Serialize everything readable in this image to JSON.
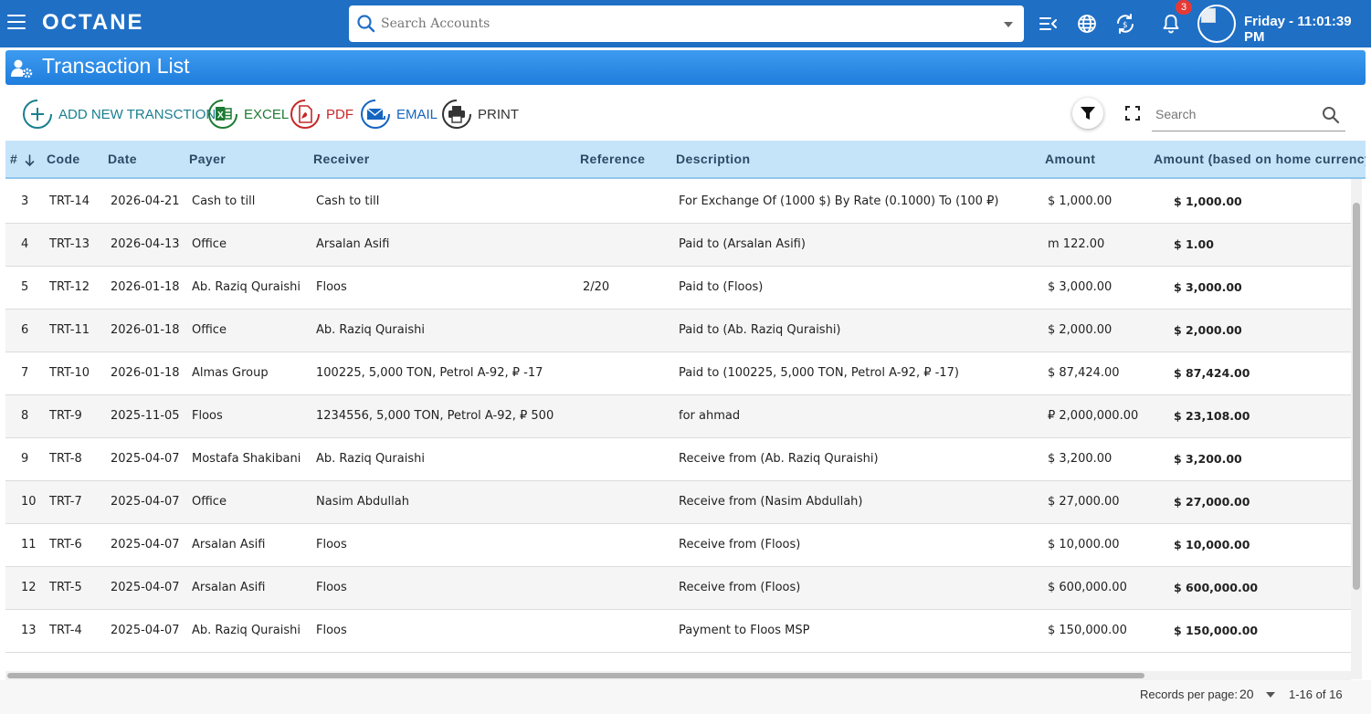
{
  "topbar": {
    "logo": "OCTANE",
    "account_search_placeholder": "Search Accounts",
    "notification_count": "3",
    "clock": "Friday - 11:01:39 PM"
  },
  "page": {
    "title": "Transaction List"
  },
  "toolbar": {
    "add_label": "ADD NEW TRANSCTION",
    "excel_label": "EXCEL",
    "pdf_label": "PDF",
    "email_label": "EMAIL",
    "print_label": "PRINT",
    "search_placeholder": "Search"
  },
  "colors": {
    "topbar": "#1f6fc5",
    "header_row": "#c6e4f9",
    "add": "#1a7f8f",
    "excel": "#1e7b34",
    "pdf": "#c62828",
    "email": "#1565c0",
    "print": "#333333"
  },
  "table": {
    "columns": [
      "#",
      "Code",
      "Date",
      "Payer",
      "Receiver",
      "Reference",
      "Description",
      "Amount",
      "Amount (based on home currency)"
    ],
    "rows": [
      [
        "3",
        "TRT-14",
        "2026-04-21",
        "Cash to till",
        "Cash to till",
        "",
        "For Exchange Of (1000 $) By Rate (0.1000) To (100 ₽)",
        "$ 1,000.00",
        "$ 1,000.00"
      ],
      [
        "4",
        "TRT-13",
        "2026-04-13",
        "Office",
        "Arsalan Asifi",
        "",
        "Paid to (Arsalan Asifi)",
        "m 122.00",
        "$ 1.00"
      ],
      [
        "5",
        "TRT-12",
        "2026-01-18",
        "Ab. Raziq Quraishi",
        "Floos",
        "2/20",
        "Paid to (Floos)",
        "$ 3,000.00",
        "$ 3,000.00"
      ],
      [
        "6",
        "TRT-11",
        "2026-01-18",
        "Office",
        "Ab. Raziq Quraishi",
        "",
        "Paid to (Ab. Raziq Quraishi)",
        "$ 2,000.00",
        "$ 2,000.00"
      ],
      [
        "7",
        "TRT-10",
        "2026-01-18",
        "Almas Group",
        "100225, 5,000 TON, Petrol A-92, ₽ -17",
        "",
        "Paid to (100225, 5,000 TON, Petrol A-92, ₽ -17)",
        "$ 87,424.00",
        "$ 87,424.00"
      ],
      [
        "8",
        "TRT-9",
        "2025-11-05",
        "Floos",
        "1234556, 5,000 TON, Petrol A-92, ₽ 500",
        "",
        "for ahmad",
        "₽ 2,000,000.00",
        "$ 23,108.00"
      ],
      [
        "9",
        "TRT-8",
        "2025-04-07",
        "Mostafa Shakibani",
        "Ab. Raziq Quraishi",
        "",
        "Receive from (Ab. Raziq Quraishi)",
        "$ 3,200.00",
        "$ 3,200.00"
      ],
      [
        "10",
        "TRT-7",
        "2025-04-07",
        "Office",
        "Nasim Abdullah",
        "",
        "Receive from (Nasim Abdullah)",
        "$ 27,000.00",
        "$ 27,000.00"
      ],
      [
        "11",
        "TRT-6",
        "2025-04-07",
        "Arsalan Asifi",
        "Floos",
        "",
        "Receive from (Floos)",
        "$ 10,000.00",
        "$ 10,000.00"
      ],
      [
        "12",
        "TRT-5",
        "2025-04-07",
        "Arsalan Asifi",
        "Floos",
        "",
        "Receive from (Floos)",
        "$ 600,000.00",
        "$ 600,000.00"
      ],
      [
        "13",
        "TRT-4",
        "2025-04-07",
        "Ab. Raziq Quraishi",
        "Floos",
        "",
        "Payment to Floos MSP",
        "$ 150,000.00",
        "$ 150,000.00"
      ]
    ]
  },
  "pagination": {
    "records_label": "Records per page:",
    "per_page": "20",
    "range": "1-16 of 16"
  }
}
